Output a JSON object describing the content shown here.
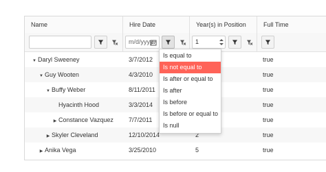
{
  "columns": [
    {
      "title": "Name"
    },
    {
      "title": "Hire Date"
    },
    {
      "title": "Year(s) in Position"
    },
    {
      "title": "Full Time"
    }
  ],
  "filters": {
    "name_value": "",
    "date_value": "m/d/yyyy",
    "years_value": "1"
  },
  "rows": [
    {
      "name": "Daryl Sweeney",
      "expander": "▼",
      "date": "3/7/2012",
      "years": "",
      "fulltime": "true"
    },
    {
      "name": "Guy Wooten",
      "expander": "▼",
      "date": "4/3/2010",
      "years": "",
      "fulltime": "true"
    },
    {
      "name": "Buffy Weber",
      "expander": "▼",
      "date": "8/11/2011",
      "years": "",
      "fulltime": "true"
    },
    {
      "name": "Hyacinth Hood",
      "expander": "",
      "date": "3/3/2014",
      "years": "",
      "fulltime": "true"
    },
    {
      "name": "Constance Vazquez",
      "expander": "▶",
      "date": "7/7/2011",
      "years": "",
      "fulltime": "true"
    },
    {
      "name": "Skyler Cleveland",
      "expander": "▶",
      "date": "12/10/2014",
      "years": "2",
      "fulltime": "true"
    },
    {
      "name": "Anika Vega",
      "expander": "▶",
      "date": "3/25/2010",
      "years": "5",
      "fulltime": "true"
    }
  ],
  "filter_menu": {
    "options": [
      "Is equal to",
      "Is not equal to",
      "Is after or equal to",
      "Is after",
      "Is before",
      "Is before or equal to",
      "Is null"
    ],
    "selected": "Is not equal to"
  },
  "colors": {
    "accent": "#ff6358",
    "header_bg": "#fafafa",
    "border": "#e1e1e1"
  }
}
